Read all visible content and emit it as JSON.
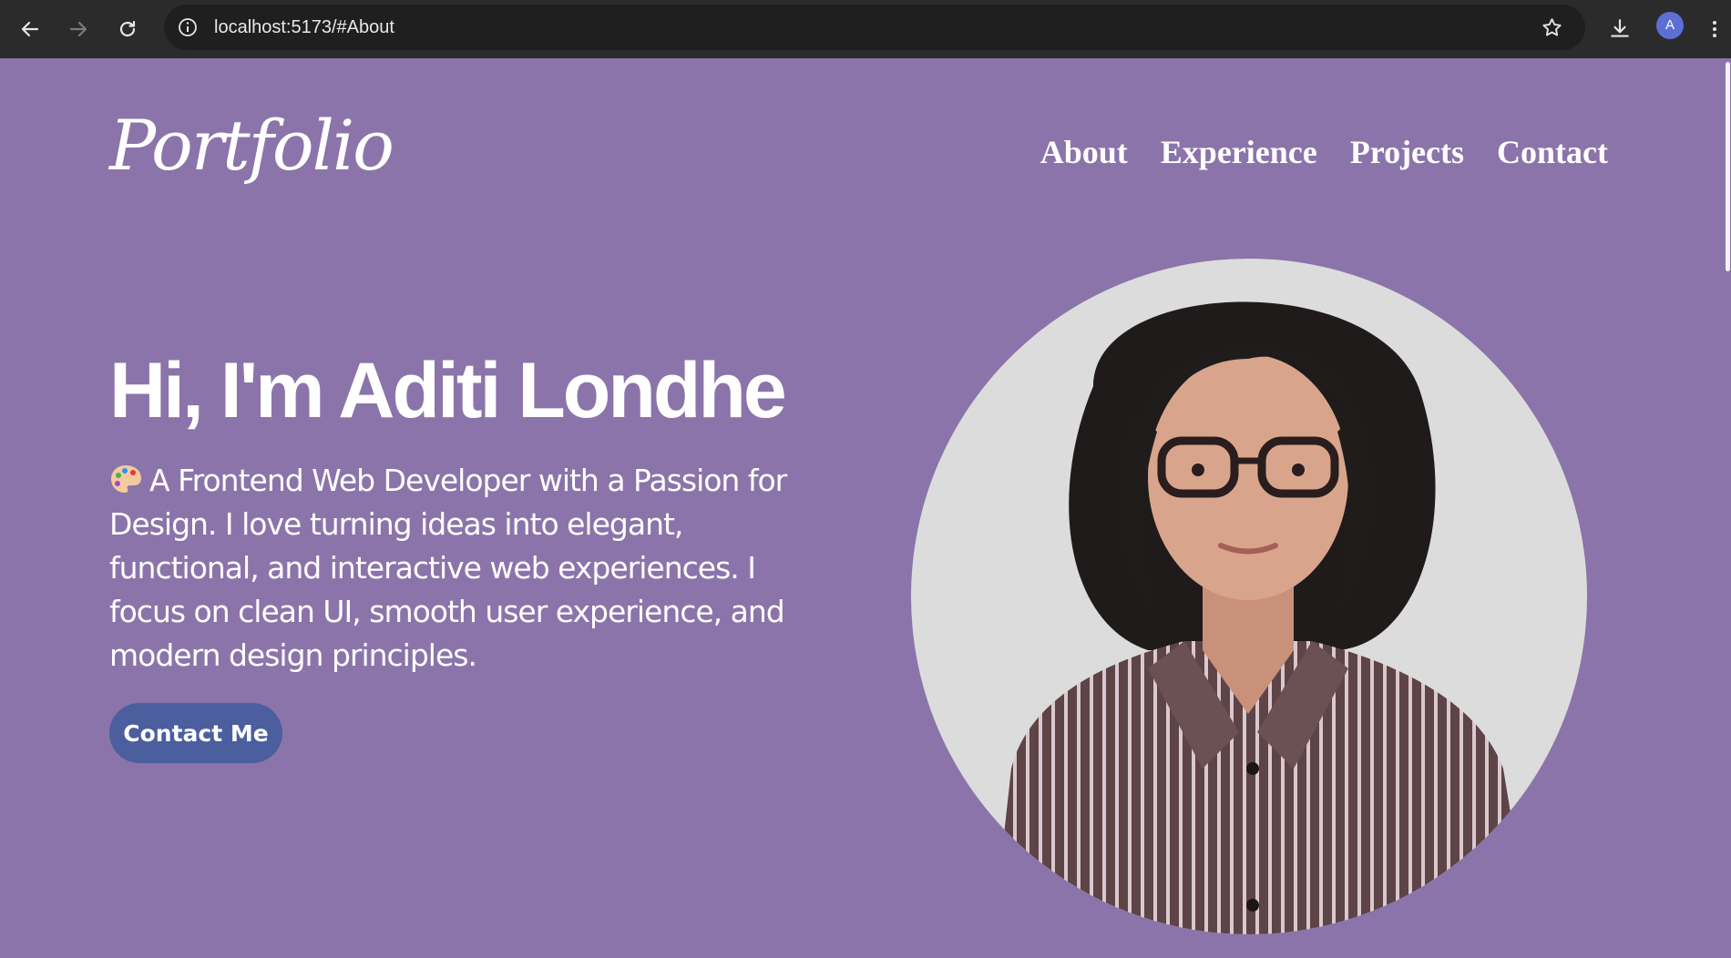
{
  "browser": {
    "url": "localhost:5173/#About",
    "profile_initial": "A"
  },
  "site": {
    "logo": "Portfolio",
    "nav": [
      "About",
      "Experience",
      "Projects",
      "Contact"
    ]
  },
  "hero": {
    "title": "Hi, I'm Aditi Londhe",
    "emoji_icon": "artist-palette-icon",
    "description": "A Frontend Web Developer with a Passion for Design. I love turning ideas into elegant, functional, and interactive web experiences. I focus on clean UI, smooth user experience, and modern design principles.",
    "cta": "Contact Me"
  },
  "colors": {
    "page_bg": "#8b74aa",
    "button_bg": "#4b5e9e",
    "chrome_bg": "#2b2b2b",
    "omnibox_bg": "#1f1f1f"
  }
}
